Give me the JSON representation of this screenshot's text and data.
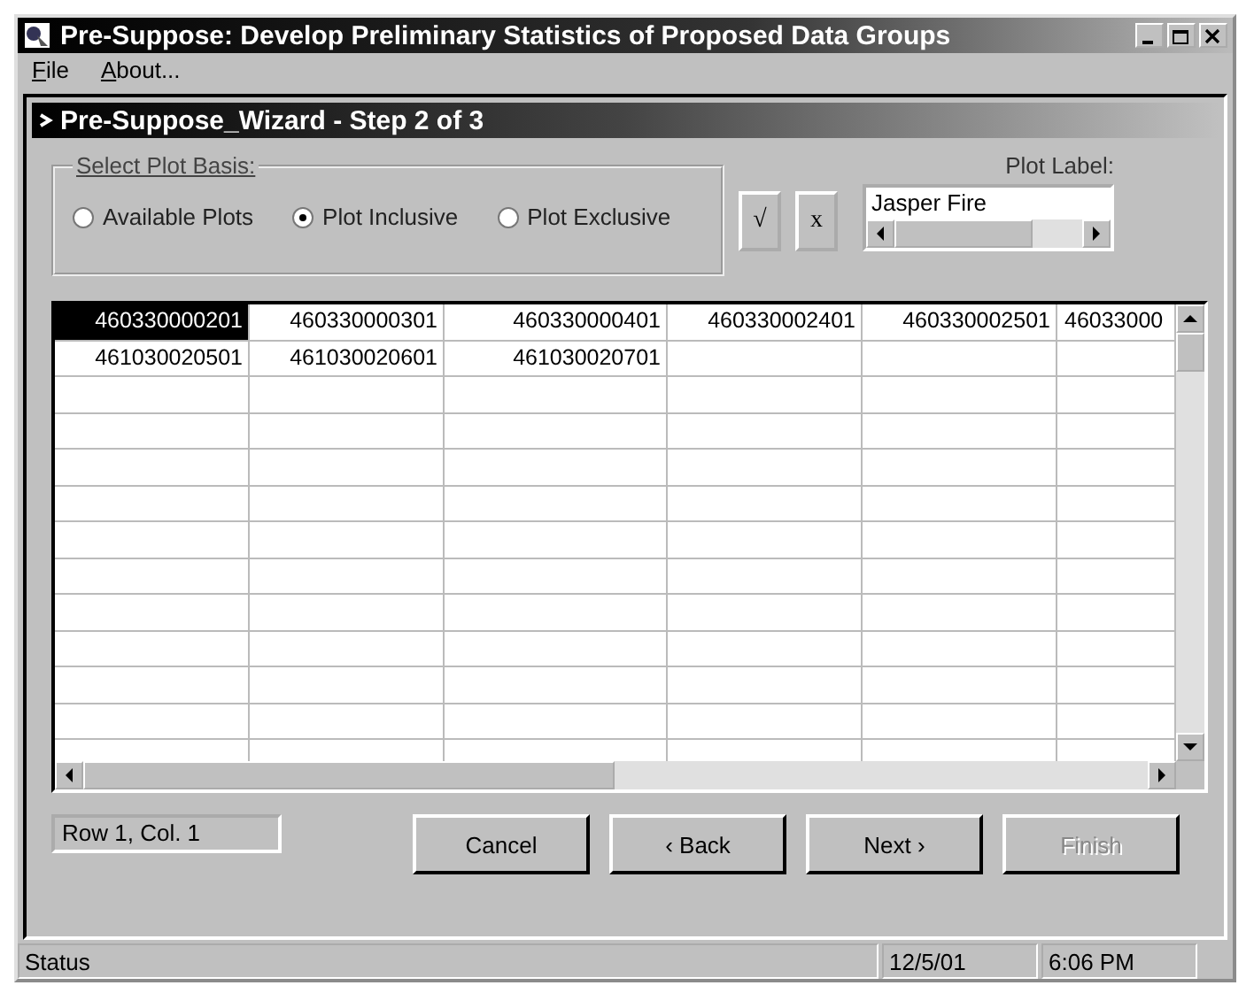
{
  "window": {
    "title": "Pre-Suppose: Develop Preliminary Statistics of Proposed Data Groups"
  },
  "menu": [
    "File",
    "About..."
  ],
  "wizard": {
    "title": "Pre-Suppose_Wizard - Step 2 of 3"
  },
  "plot_basis": {
    "legend": "Select Plot Basis:",
    "options": [
      {
        "label": "Available Plots",
        "selected": false
      },
      {
        "label": "Plot Inclusive",
        "selected": true
      },
      {
        "label": "Plot Exclusive",
        "selected": false
      }
    ]
  },
  "tool_buttons": [
    "√",
    "x"
  ],
  "plot_label": {
    "label": "Plot Label:",
    "value": "Jasper Fire"
  },
  "grid": {
    "rows": [
      {
        "cells": [
          {
            "text": "460330000201",
            "selected": true
          },
          {
            "text": "460330000301",
            "selected": false
          },
          {
            "text": "460330000401",
            "selected": false
          },
          {
            "text": "460330002401",
            "selected": false
          },
          {
            "text": "460330002501",
            "selected": false
          },
          {
            "text": "46033000",
            "selected": false
          }
        ]
      },
      {
        "cells": [
          {
            "text": "461030020501",
            "selected": false
          },
          {
            "text": "461030020601",
            "selected": false
          },
          {
            "text": "461030020701",
            "selected": false
          }
        ]
      }
    ]
  },
  "position": "Row 1, Col. 1",
  "buttons": [
    {
      "label": "Cancel",
      "disabled": false
    },
    {
      "label": "‹ Back",
      "disabled": false
    },
    {
      "label": "Next ›",
      "disabled": false
    },
    {
      "label": "Finish",
      "disabled": true
    }
  ],
  "status_bar": [
    "Status",
    "12/5/01",
    "6:06 PM"
  ]
}
